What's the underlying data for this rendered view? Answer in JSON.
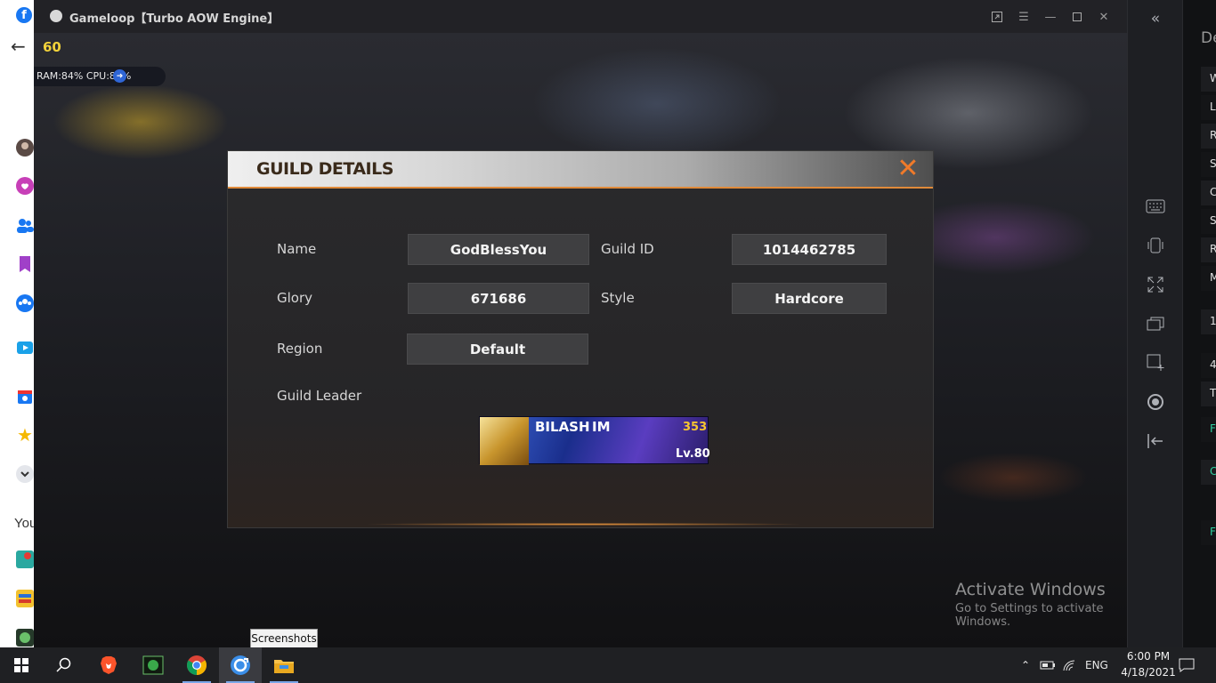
{
  "window": {
    "title": "Gameloop【Turbo AOW Engine】"
  },
  "overlay": {
    "fps": "60",
    "perf": "RAM:84%  CPU:80%"
  },
  "dialog": {
    "title": "GUILD DETAILS",
    "close_icon": "close-icon",
    "fields": {
      "name_label": "Name",
      "name_value": "GodBlessYou",
      "guild_id_label": "Guild ID",
      "guild_id_value": "1014462785",
      "glory_label": "Glory",
      "glory_value": "671686",
      "style_label": "Style",
      "style_value": "Hardcore",
      "region_label": "Region",
      "region_value": "Default",
      "leader_label": "Guild Leader"
    },
    "leader": {
      "name": "BILASH",
      "tag": "IM",
      "rank": "353",
      "level": "Lv.80"
    }
  },
  "watermark": {
    "title": "Activate Windows",
    "subtitle": "Go to Settings to activate Windows."
  },
  "facebook_strip": {
    "you_label": "You"
  },
  "right_panel": {
    "title": "De",
    "rows": [
      "W",
      "Lo",
      "R",
      "S",
      "C",
      "S",
      "R",
      "M",
      "1",
      "4",
      "T",
      "F",
      "C",
      "F"
    ]
  },
  "tooltip": "Screenshots",
  "taskbar": {
    "lang": "ENG",
    "time": "6:00 PM",
    "date": "4/18/2021"
  },
  "colors": {
    "accent_orange": "#f07a2a",
    "fps_yellow": "#f2d23a",
    "dialog_bg": "#2a2a2c"
  }
}
